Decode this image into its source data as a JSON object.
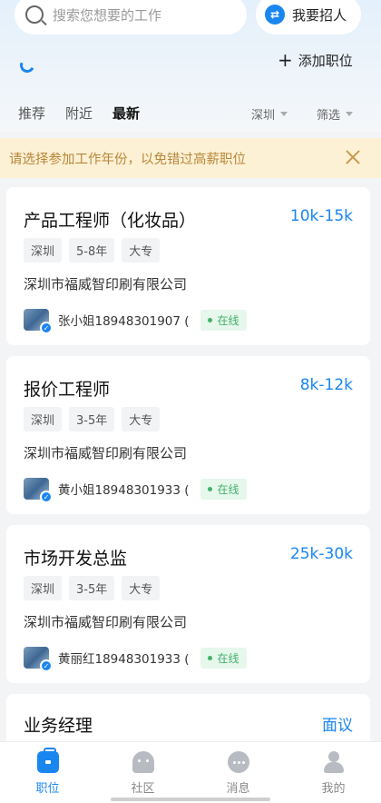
{
  "search": {
    "placeholder": "搜索您想要的工作"
  },
  "recruit_button": "我要招人",
  "add_job": "添加职位",
  "filter_tabs": [
    "推荐",
    "附近",
    "最新"
  ],
  "city_filter": "深圳",
  "screen_filter": "筛选",
  "notice": "请选择参加工作年份，以免错过高薪职位",
  "jobs": [
    {
      "title": "产品工程师（化妆品）",
      "salary": "10k-15k",
      "tags": [
        "深圳",
        "5-8年",
        "大专"
      ],
      "company": "深圳市福威智印刷有限公司",
      "contact": "张小姐18948301907 (",
      "status": "在线"
    },
    {
      "title": "报价工程师",
      "salary": "8k-12k",
      "tags": [
        "深圳",
        "3-5年",
        "大专"
      ],
      "company": "深圳市福威智印刷有限公司",
      "contact": "黄小姐18948301933 (",
      "status": "在线"
    },
    {
      "title": "市场开发总监",
      "salary": "25k-30k",
      "tags": [
        "深圳",
        "3-5年",
        "大专"
      ],
      "company": "深圳市福威智印刷有限公司",
      "contact": "黄丽红18948301933 (",
      "status": "在线"
    },
    {
      "title": "业务经理",
      "salary": "面议"
    }
  ],
  "bottom_nav": [
    "职位",
    "社区",
    "消息",
    "我的"
  ],
  "colors": {
    "accent": "#1a86f0",
    "notice_bg": "#fdf1d5",
    "notice_text": "#b8873a",
    "online": "#43b06a"
  }
}
